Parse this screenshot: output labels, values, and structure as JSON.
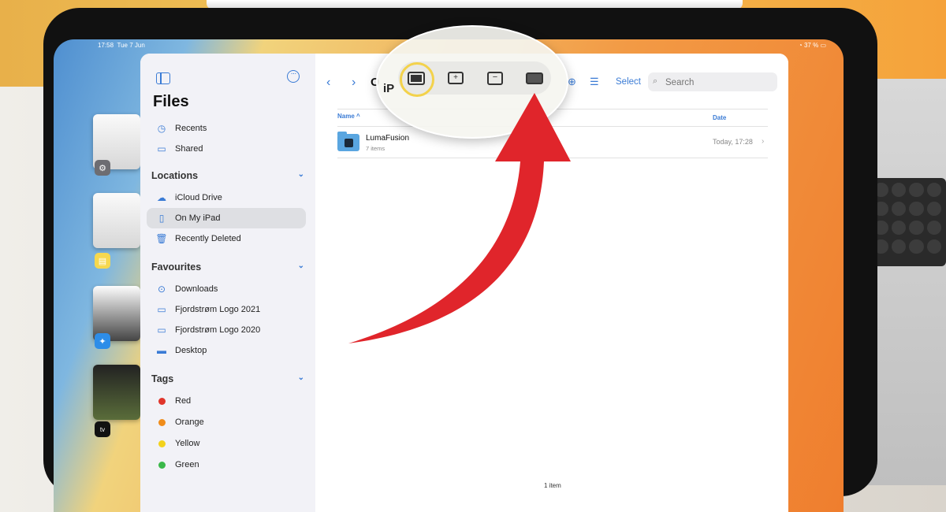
{
  "status_bar": {
    "time": "17:58",
    "date": "Tue 7 Jun",
    "battery": "37 %"
  },
  "sidebar": {
    "title": "Files",
    "top_items": [
      {
        "label": "Recents",
        "icon": "clock-icon"
      },
      {
        "label": "Shared",
        "icon": "shared-folder-icon"
      }
    ],
    "sections": {
      "locations": {
        "title": "Locations",
        "items": [
          {
            "label": "iCloud Drive",
            "icon": "cloud-icon"
          },
          {
            "label": "On My iPad",
            "icon": "ipad-icon",
            "selected": true
          },
          {
            "label": "Recently Deleted",
            "icon": "trash-icon"
          }
        ]
      },
      "favourites": {
        "title": "Favourites",
        "items": [
          {
            "label": "Downloads",
            "icon": "download-icon"
          },
          {
            "label": "Fjordstrøm Logo 2021",
            "icon": "folder-icon"
          },
          {
            "label": "Fjordstrøm Logo 2020",
            "icon": "folder-icon"
          },
          {
            "label": "Desktop",
            "icon": "desktop-icon"
          }
        ]
      },
      "tags": {
        "title": "Tags",
        "items": [
          {
            "label": "Red",
            "color": "#e0352b"
          },
          {
            "label": "Orange",
            "color": "#f08c1a"
          },
          {
            "label": "Yellow",
            "color": "#f3d21c"
          },
          {
            "label": "Green",
            "color": "#3bb84a"
          }
        ]
      }
    }
  },
  "toolbar": {
    "title_partial": "O",
    "select_label": "Select",
    "search_placeholder": "Search"
  },
  "columns": {
    "name": "Name ^",
    "date": "Date"
  },
  "files": [
    {
      "name": "LumaFusion",
      "subtitle": "7 items",
      "date": "Today, 17:28"
    }
  ],
  "footer": {
    "item_count": "1 item"
  },
  "lens": {
    "partial_label": "iP"
  },
  "colors": {
    "accent": "#3a7bd5",
    "arrow": "#e0252b",
    "highlight_ring": "#f3d24b"
  }
}
